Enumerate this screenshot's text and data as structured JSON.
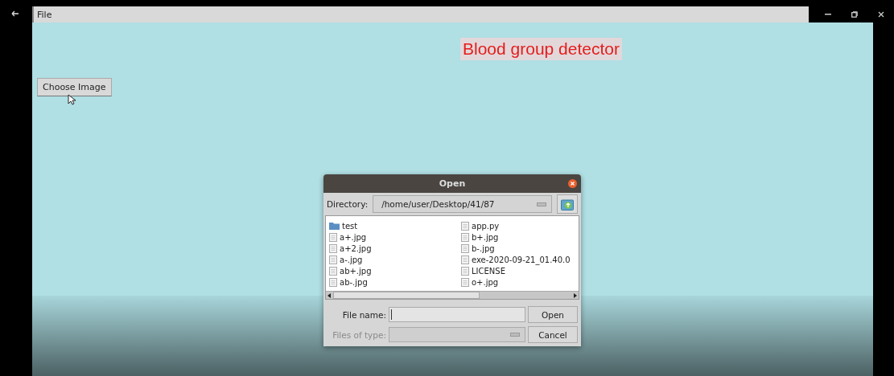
{
  "menu_bar": {
    "items": [
      "File"
    ]
  },
  "app": {
    "title": "Blood group detector",
    "choose_button": "Choose Image"
  },
  "dialog": {
    "title": "Open",
    "directory_label": "Directory:",
    "directory": "/home/user/Desktop/41/87",
    "files": [
      {
        "name": "test",
        "kind": "folder"
      },
      {
        "name": "a+.jpg",
        "kind": "file"
      },
      {
        "name": "a+2.jpg",
        "kind": "file"
      },
      {
        "name": "a-.jpg",
        "kind": "file"
      },
      {
        "name": "ab+.jpg",
        "kind": "file"
      },
      {
        "name": "ab-.jpg",
        "kind": "file"
      },
      {
        "name": "app.py",
        "kind": "file"
      },
      {
        "name": "b+.jpg",
        "kind": "file"
      },
      {
        "name": "b-.jpg",
        "kind": "file"
      },
      {
        "name": "exe-2020-09-21_01.40.0",
        "kind": "file"
      },
      {
        "name": "LICENSE",
        "kind": "file"
      },
      {
        "name": "o+.jpg",
        "kind": "file"
      }
    ],
    "file_name_label": "File name:",
    "file_type_label": "Files of type:",
    "file_type_disabled": true,
    "buttons": [
      "Open",
      "Cancel"
    ]
  }
}
